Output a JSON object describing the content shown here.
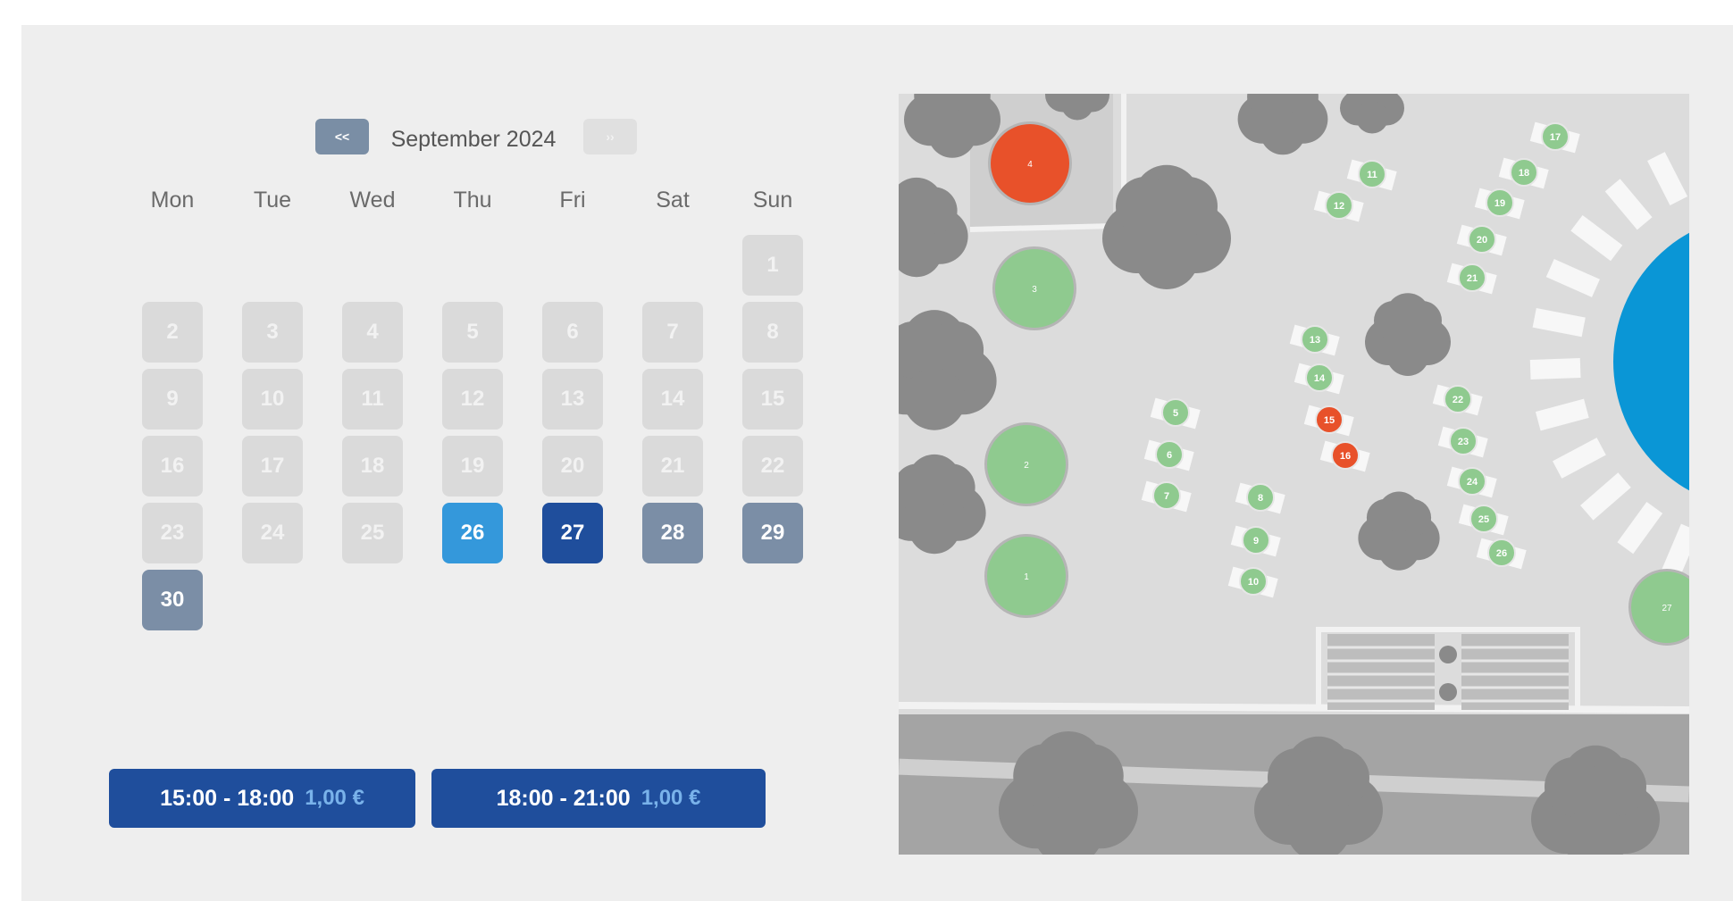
{
  "calendar": {
    "prev_label": "<<",
    "next_label": "››",
    "month_title": "September 2024",
    "weekdays": [
      "Mon",
      "Tue",
      "Wed",
      "Thu",
      "Fri",
      "Sat",
      "Sun"
    ],
    "days": [
      {
        "n": "1",
        "state": "disabled"
      },
      {
        "n": "2",
        "state": "disabled"
      },
      {
        "n": "3",
        "state": "disabled"
      },
      {
        "n": "4",
        "state": "disabled"
      },
      {
        "n": "5",
        "state": "disabled"
      },
      {
        "n": "6",
        "state": "disabled"
      },
      {
        "n": "7",
        "state": "disabled"
      },
      {
        "n": "8",
        "state": "disabled"
      },
      {
        "n": "9",
        "state": "disabled"
      },
      {
        "n": "10",
        "state": "disabled"
      },
      {
        "n": "11",
        "state": "disabled"
      },
      {
        "n": "12",
        "state": "disabled"
      },
      {
        "n": "13",
        "state": "disabled"
      },
      {
        "n": "14",
        "state": "disabled"
      },
      {
        "n": "15",
        "state": "disabled"
      },
      {
        "n": "16",
        "state": "disabled"
      },
      {
        "n": "17",
        "state": "disabled"
      },
      {
        "n": "18",
        "state": "disabled"
      },
      {
        "n": "19",
        "state": "disabled"
      },
      {
        "n": "20",
        "state": "disabled"
      },
      {
        "n": "21",
        "state": "disabled"
      },
      {
        "n": "22",
        "state": "disabled"
      },
      {
        "n": "23",
        "state": "disabled"
      },
      {
        "n": "24",
        "state": "disabled"
      },
      {
        "n": "25",
        "state": "disabled"
      },
      {
        "n": "26",
        "state": "today"
      },
      {
        "n": "27",
        "state": "selected"
      },
      {
        "n": "28",
        "state": "available"
      },
      {
        "n": "29",
        "state": "available"
      },
      {
        "n": "30",
        "state": "available"
      }
    ]
  },
  "slots": [
    {
      "time": "15:00 - 18:00",
      "price": "1,00 €"
    },
    {
      "time": "18:00 - 21:00",
      "price": "1,00 €"
    }
  ],
  "map": {
    "colors": {
      "ground": "#dcdcdc",
      "tree": "#8a8a8a",
      "free": "#8fca8f",
      "taken": "#e8512a",
      "pool": "#0a96d6",
      "sunbed": "#f7f7f7",
      "path": "#a4a4a4"
    },
    "large_tables": [
      {
        "label": "4",
        "status": "taken"
      },
      {
        "label": "3",
        "status": "free"
      },
      {
        "label": "2",
        "status": "free"
      },
      {
        "label": "1",
        "status": "free"
      },
      {
        "label": "27",
        "status": "free"
      }
    ],
    "spots": [
      {
        "label": "5",
        "status": "free"
      },
      {
        "label": "6",
        "status": "free"
      },
      {
        "label": "7",
        "status": "free"
      },
      {
        "label": "8",
        "status": "free"
      },
      {
        "label": "9",
        "status": "free"
      },
      {
        "label": "10",
        "status": "free"
      },
      {
        "label": "11",
        "status": "free"
      },
      {
        "label": "12",
        "status": "free"
      },
      {
        "label": "13",
        "status": "free"
      },
      {
        "label": "14",
        "status": "free"
      },
      {
        "label": "15",
        "status": "taken"
      },
      {
        "label": "16",
        "status": "taken"
      },
      {
        "label": "17",
        "status": "free"
      },
      {
        "label": "18",
        "status": "free"
      },
      {
        "label": "19",
        "status": "free"
      },
      {
        "label": "20",
        "status": "free"
      },
      {
        "label": "21",
        "status": "free"
      },
      {
        "label": "22",
        "status": "free"
      },
      {
        "label": "23",
        "status": "free"
      },
      {
        "label": "24",
        "status": "free"
      },
      {
        "label": "25",
        "status": "free"
      },
      {
        "label": "26",
        "status": "free"
      }
    ]
  }
}
